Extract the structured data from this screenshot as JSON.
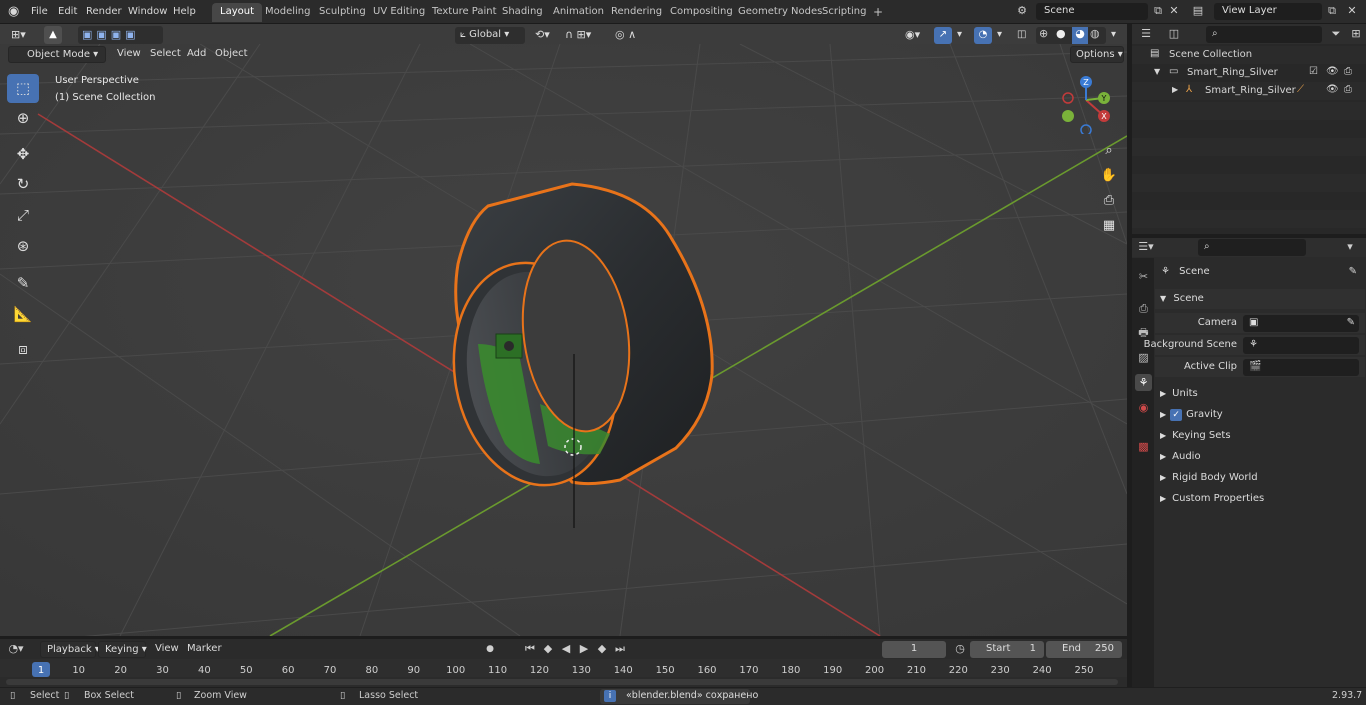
{
  "topbar": {
    "menus": [
      "File",
      "Edit",
      "Render",
      "Window",
      "Help"
    ],
    "workspaces": [
      "Layout",
      "Modeling",
      "Sculpting",
      "UV Editing",
      "Texture Paint",
      "Shading",
      "Animation",
      "Rendering",
      "Compositing",
      "Geometry Nodes",
      "Scripting"
    ],
    "active_workspace": "Layout",
    "add_tab": "+",
    "scene_name": "Scene",
    "view_layer": "View Layer"
  },
  "viewport_header": {
    "mode": "Object Mode",
    "menus": [
      "View",
      "Select",
      "Add",
      "Object"
    ],
    "transform_orientation": "Global",
    "options_label": "Options"
  },
  "viewport": {
    "perspective_label": "User Perspective",
    "collection_label": "(1) Scene Collection",
    "gizmo_axes": [
      "X",
      "Y",
      "Z"
    ]
  },
  "outliner": {
    "root": "Scene Collection",
    "items": [
      {
        "label": "Smart_Ring_Silver",
        "type": "collection"
      },
      {
        "label": "Smart_Ring_Silver",
        "type": "object"
      }
    ]
  },
  "properties": {
    "context": "Scene",
    "panel_title": "Scene",
    "fields": [
      {
        "label": "Camera"
      },
      {
        "label": "Background Scene"
      },
      {
        "label": "Active Clip"
      }
    ],
    "subpanels": [
      "Units",
      "Gravity",
      "Keying Sets",
      "Audio",
      "Rigid Body World",
      "Custom Properties"
    ],
    "gravity_checked": true
  },
  "timeline": {
    "menus": [
      "Playback",
      "Keying",
      "View",
      "Marker"
    ],
    "current_frame": "1",
    "start_label": "Start",
    "start_value": "1",
    "end_label": "End",
    "end_value": "250",
    "ticks": [
      "1",
      "10",
      "20",
      "30",
      "40",
      "50",
      "60",
      "70",
      "80",
      "90",
      "100",
      "110",
      "120",
      "130",
      "140",
      "150",
      "160",
      "170",
      "180",
      "190",
      "200",
      "210",
      "220",
      "230",
      "240",
      "250"
    ]
  },
  "statusbar": {
    "hints": [
      "Select",
      "Box Select",
      "Zoom View",
      "Lasso Select"
    ],
    "message": "«blender.blend» сохранено",
    "version": "2.93.7"
  },
  "colors": {
    "accent": "#4772b3",
    "selection_outline": "#e8731a",
    "x_axis": "#c23b3b",
    "y_axis": "#7ab23a",
    "z_axis": "#3a7bd5"
  }
}
